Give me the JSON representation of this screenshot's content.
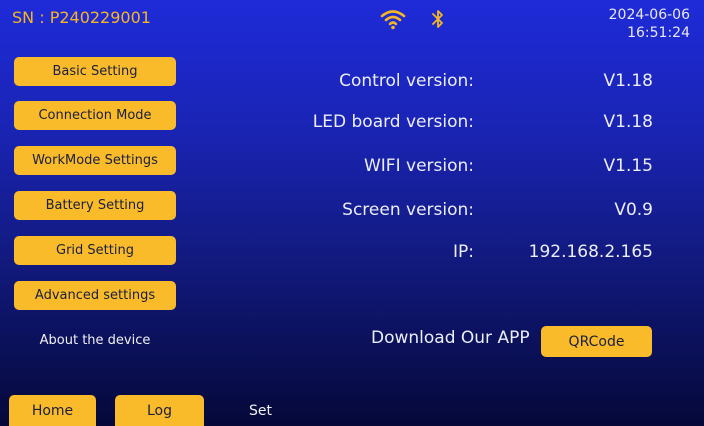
{
  "header": {
    "serial": "SN : P240229001",
    "date": "2024-06-06",
    "time": "16:51:24",
    "wifi_icon": "wifi-icon",
    "bluetooth_icon": "bluetooth-icon"
  },
  "sidebar": {
    "items": [
      {
        "label": "Basic Setting"
      },
      {
        "label": "Connection Mode"
      },
      {
        "label": "WorkMode Settings"
      },
      {
        "label": "Battery Setting"
      },
      {
        "label": "Grid Setting"
      },
      {
        "label": "Advanced settings"
      },
      {
        "label": "About the device",
        "active": true
      }
    ]
  },
  "info": {
    "rows": [
      {
        "label": "Control version:",
        "value": "V1.18"
      },
      {
        "label": "LED board version:",
        "value": "V1.18"
      },
      {
        "label": "WIFI version:",
        "value": "V1.15"
      },
      {
        "label": "Screen version:",
        "value": "V0.9"
      },
      {
        "label": "IP:",
        "value": "192.168.2.165"
      }
    ],
    "download_label": "Download Our APP",
    "qr_button": "QRCode"
  },
  "bottom_nav": {
    "home": "Home",
    "log": "Log",
    "set": "Set"
  },
  "colors": {
    "accent": "#f9bb2a",
    "serial_text": "#f5b622",
    "background_top": "#1e2bd8",
    "background_bottom": "#050838"
  }
}
